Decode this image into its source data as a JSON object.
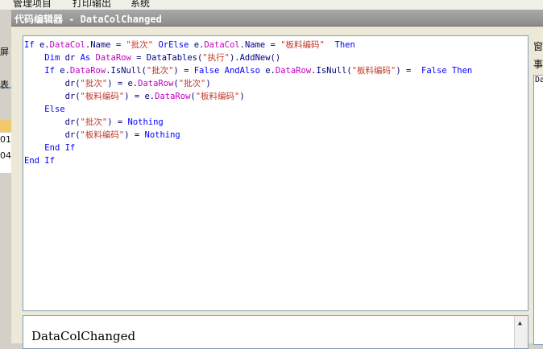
{
  "background_app": {
    "menu": [
      "管理项目",
      "打印输出",
      "系统"
    ],
    "left_fragments": [
      "屏",
      "表",
      "01_",
      "04_"
    ]
  },
  "window": {
    "title": "代码编辑器 - DataColChanged"
  },
  "code": [
    [
      [
        "kw",
        "If "
      ],
      [
        "tx",
        "e."
      ],
      [
        "pr",
        "DataCol"
      ],
      [
        "tx",
        ".Name = "
      ],
      [
        "st",
        "\"批次\""
      ],
      [
        "kw",
        " OrElse "
      ],
      [
        "tx",
        "e."
      ],
      [
        "pr",
        "DataCol"
      ],
      [
        "tx",
        ".Name = "
      ],
      [
        "st",
        "\"板料编码\""
      ],
      [
        "kw",
        "  Then"
      ]
    ],
    [
      [
        "tx",
        "    "
      ],
      [
        "kw",
        "Dim "
      ],
      [
        "tx",
        "dr "
      ],
      [
        "kw",
        "As "
      ],
      [
        "pr",
        "DataRow"
      ],
      [
        "tx",
        " = DataTables("
      ],
      [
        "st",
        "\"执行\""
      ],
      [
        "tx",
        ").AddNew()"
      ]
    ],
    [
      [
        "tx",
        "    "
      ],
      [
        "kw",
        "If "
      ],
      [
        "tx",
        "e."
      ],
      [
        "pr",
        "DataRow"
      ],
      [
        "tx",
        ".IsNull("
      ],
      [
        "st",
        "\"批次\""
      ],
      [
        "tx",
        ") = "
      ],
      [
        "kw",
        "False AndAlso "
      ],
      [
        "tx",
        "e."
      ],
      [
        "pr",
        "DataRow"
      ],
      [
        "tx",
        ".IsNull("
      ],
      [
        "st",
        "\"板料编码\""
      ],
      [
        "tx",
        ") =  "
      ],
      [
        "kw",
        "False Then"
      ]
    ],
    [
      [
        "tx",
        "        dr("
      ],
      [
        "st",
        "\"批次\""
      ],
      [
        "tx",
        ") = e."
      ],
      [
        "pr",
        "DataRow"
      ],
      [
        "tx",
        "("
      ],
      [
        "st",
        "\"批次\""
      ],
      [
        "tx",
        ")"
      ]
    ],
    [
      [
        "tx",
        "        dr("
      ],
      [
        "st",
        "\"板料编码\""
      ],
      [
        "tx",
        ") = e."
      ],
      [
        "pr",
        "DataRow"
      ],
      [
        "tx",
        "("
      ],
      [
        "st",
        "\"板料编码\""
      ],
      [
        "tx",
        ")"
      ]
    ],
    [
      [
        "tx",
        "    "
      ],
      [
        "kw",
        "Else"
      ]
    ],
    [
      [
        "tx",
        "        dr("
      ],
      [
        "st",
        "\"批次\""
      ],
      [
        "tx",
        ") = "
      ],
      [
        "kw",
        "Nothing"
      ]
    ],
    [
      [
        "tx",
        "        dr("
      ],
      [
        "st",
        "\"板料编码\""
      ],
      [
        "tx",
        ") = "
      ],
      [
        "kw",
        "Nothing"
      ]
    ],
    [
      [
        "tx",
        "    "
      ],
      [
        "kw",
        "End If"
      ]
    ],
    [
      [
        "kw",
        "End If"
      ]
    ]
  ],
  "bottom_panel": {
    "event_name": "DataColChanged"
  },
  "right_panel": {
    "labels": [
      "窗",
      "事"
    ],
    "box_text": "Da"
  }
}
